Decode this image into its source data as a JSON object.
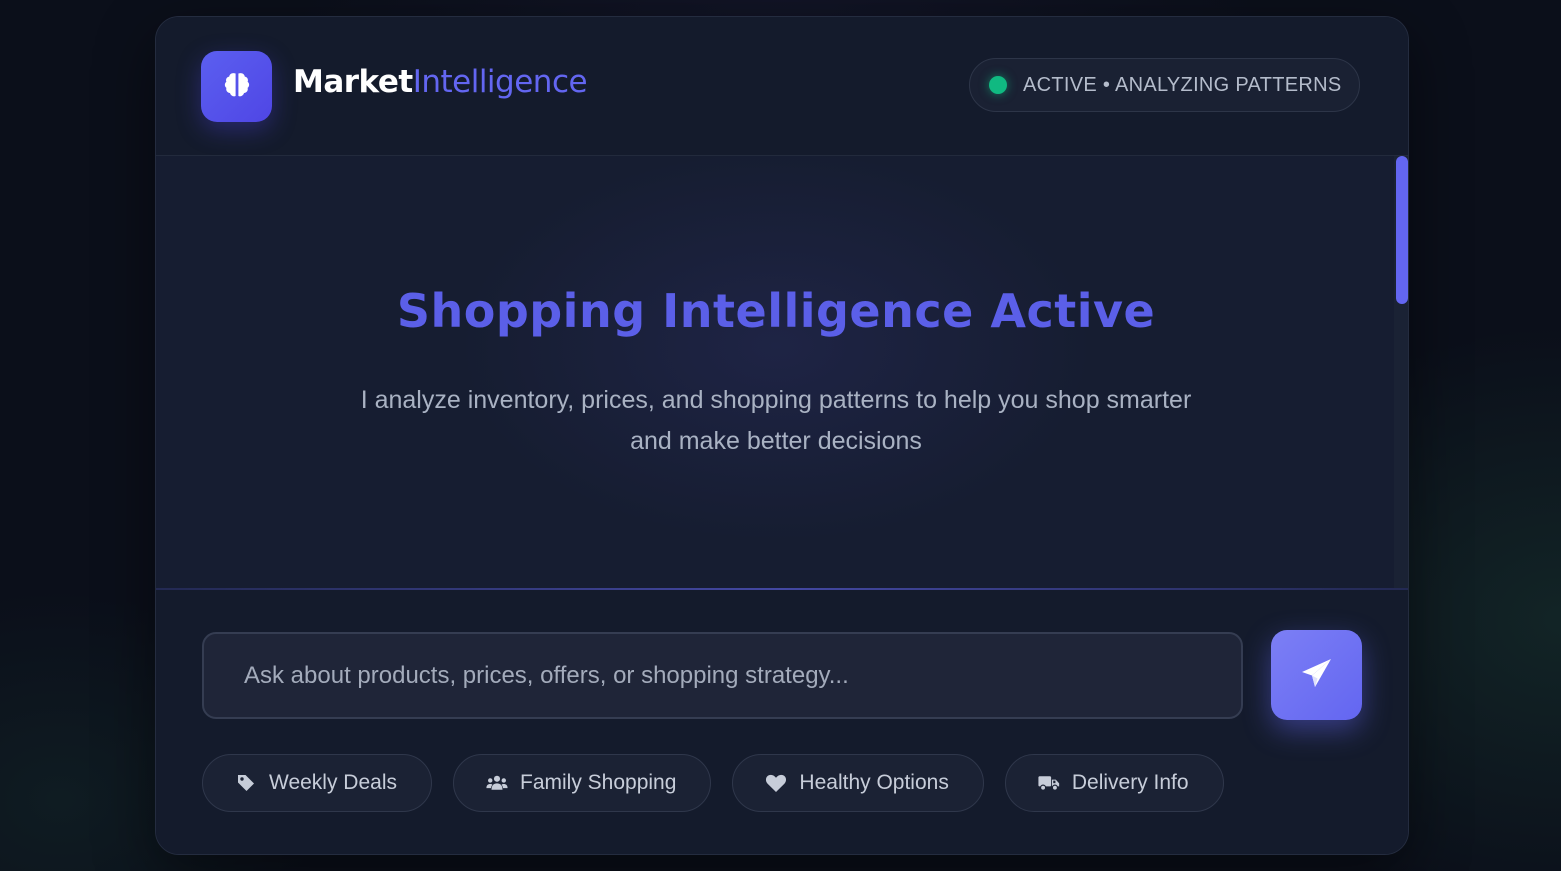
{
  "header": {
    "brand_part1": "Market",
    "brand_part2": "Intelligence",
    "status_text": "ACTIVE • ANALYZING PATTERNS",
    "logo_icon": "brain-icon",
    "status_color": "#10b981"
  },
  "hero": {
    "title": "Shopping Intelligence Active",
    "subtitle": "I analyze inventory, prices, and shopping patterns to help you shop smarter and make better decisions"
  },
  "composer": {
    "placeholder": "Ask about products, prices, offers, or shopping strategy...",
    "value": "",
    "send_icon": "paper-plane-icon"
  },
  "quick_actions": [
    {
      "label": "Weekly Deals",
      "icon": "tag-icon"
    },
    {
      "label": "Family Shopping",
      "icon": "users-icon"
    },
    {
      "label": "Healthy Options",
      "icon": "heart-icon"
    },
    {
      "label": "Delivery Info",
      "icon": "truck-icon"
    }
  ],
  "colors": {
    "accent": "#6366f1",
    "background": "#0b0f1a",
    "panel": "#131a2b",
    "status_green": "#10b981"
  }
}
